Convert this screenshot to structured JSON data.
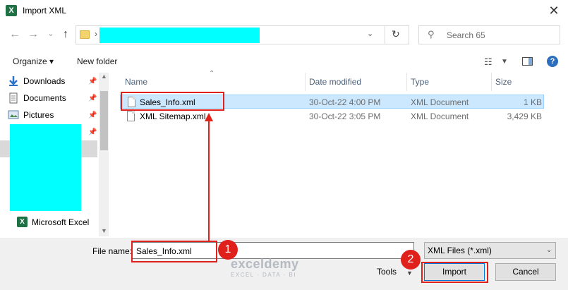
{
  "window": {
    "title": "Import XML",
    "app_icon": "X"
  },
  "nav": {
    "back": "←",
    "forward": "→",
    "dropdown": "⌄",
    "up": "↑",
    "refresh": "↻"
  },
  "address": {
    "separator": "›"
  },
  "search": {
    "placeholder": "Search 65"
  },
  "toolbar": {
    "organize_label": "Organize ▾",
    "new_folder_label": "New folder"
  },
  "sidebar": {
    "items": [
      {
        "label": "Downloads"
      },
      {
        "label": "Documents"
      },
      {
        "label": "Pictures"
      },
      {
        "label": "Microsoft Excel"
      }
    ]
  },
  "file_list": {
    "columns": [
      "Name",
      "Date modified",
      "Type",
      "Size"
    ],
    "rows": [
      {
        "name": "Sales_Info.xml",
        "date": "30-Oct-22 4:00 PM",
        "type": "XML Document",
        "size": "1 KB",
        "selected": true
      },
      {
        "name": "XML Sitemap.xml",
        "date": "30-Oct-22 3:05 PM",
        "type": "XML Document",
        "size": "3,429 KB",
        "selected": false
      }
    ]
  },
  "bottom": {
    "file_name_label": "File name:",
    "file_name_value": "Sales_Info.xml",
    "file_type": "XML Files (*.xml)",
    "tools_label": "Tools",
    "import_label": "Import",
    "cancel_label": "Cancel"
  },
  "annotations": {
    "step1": "1",
    "step2": "2",
    "highlight_color": "#e0201b"
  },
  "watermark": {
    "name": "exceldemy",
    "sub": "EXCEL · DATA · BI"
  }
}
